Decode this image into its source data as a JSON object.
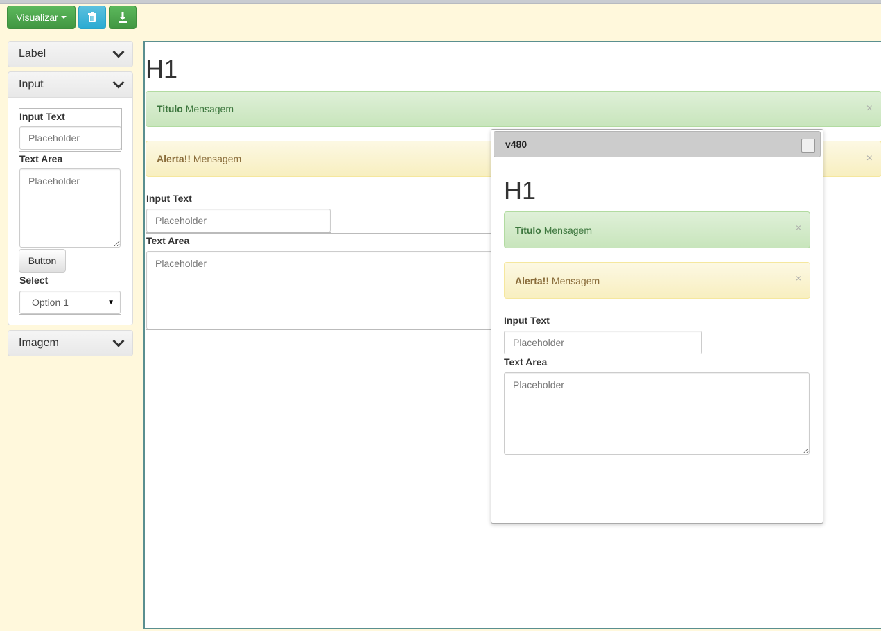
{
  "toolbar": {
    "visualize_label": "Visualizar"
  },
  "sidebar": {
    "panels": [
      {
        "label": "Label"
      },
      {
        "label": "Input"
      },
      {
        "label": "Imagem"
      }
    ],
    "input_panel": {
      "input_text_label": "Input Text",
      "input_text_placeholder": "Placeholder",
      "text_area_label": "Text Area",
      "text_area_placeholder": "Placeholder",
      "button_label": "Button",
      "select_label": "Select",
      "select_value": "Option 1"
    }
  },
  "canvas": {
    "heading": "H1",
    "alerts": [
      {
        "title": "Titulo",
        "message": "Mensagem"
      },
      {
        "title": "Alerta!!",
        "message": "Mensagem"
      }
    ],
    "input_text_label": "Input Text",
    "input_text_placeholder": "Placeholder",
    "text_area_label": "Text Area",
    "text_area_placeholder": "Placeholder",
    "close_glyph": "×"
  },
  "preview": {
    "title": "v480",
    "heading": "H1",
    "alerts": [
      {
        "title": "Titulo",
        "message": "Mensagem"
      },
      {
        "title": "Alerta!!",
        "message": "Mensagem"
      }
    ],
    "input_text_label": "Input Text",
    "input_text_placeholder": "Placeholder",
    "text_area_label": "Text Area",
    "text_area_placeholder": "Placeholder",
    "close_glyph": "×"
  },
  "colors": {
    "page_background": "#fff8dc",
    "success_button": "#5cb85c",
    "info_button": "#5bc0de",
    "success_alert": "#dff0d8",
    "warning_alert": "#fcf8e3",
    "canvas_border": "#5a8f8f"
  },
  "icons": {
    "delete": "trash-icon",
    "download": "download-icon",
    "collapse": "chevron-down-icon"
  }
}
